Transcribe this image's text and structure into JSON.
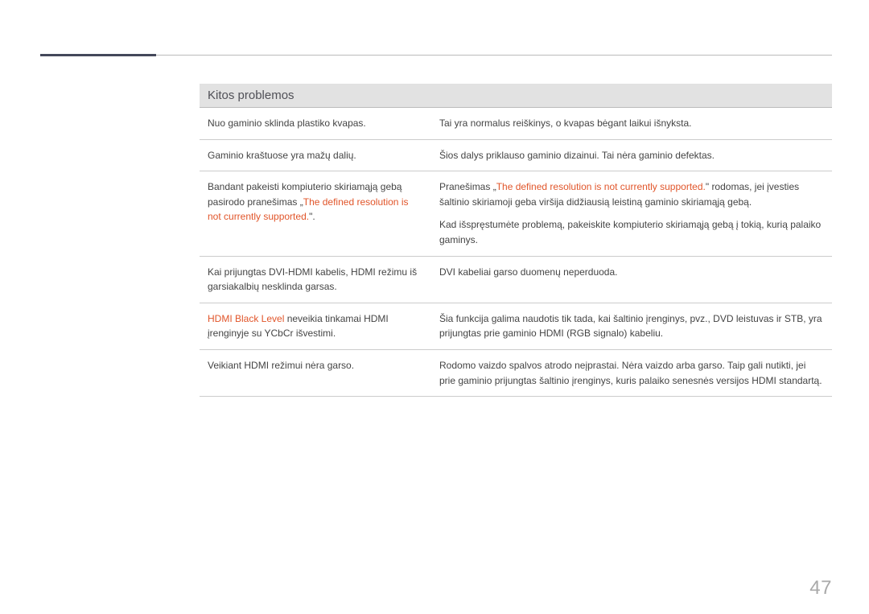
{
  "section_title": "Kitos problemos",
  "rows": [
    {
      "left_plain": "Nuo gaminio sklinda plastiko kvapas.",
      "right_plain": "Tai yra normalus reiškinys, o kvapas bėgant laikui išnyksta."
    },
    {
      "left_plain": "Gaminio kraštuose yra mažų dalių.",
      "right_plain": "Šios dalys priklauso gaminio dizainui. Tai nėra gaminio defektas."
    },
    {
      "left_pre": "Bandant pakeisti kompiuterio skiriamąją gebą pasirodo pranešimas „",
      "left_hl": "The defined resolution is not currently supported.",
      "left_post": "\".",
      "right_p1_pre": "Pranešimas „",
      "right_p1_hl": "The defined resolution is not currently supported.",
      "right_p1_post": "\" rodomas, jei įvesties šaltinio skiriamoji geba viršija didžiausią leistiną gaminio skiriamąją gebą.",
      "right_p2": "Kad išspręstumėte problemą, pakeiskite kompiuterio skiriamąją gebą į tokią, kurią palaiko gaminys."
    },
    {
      "left_plain": "Kai prijungtas DVI-HDMI kabelis, HDMI režimu iš garsiakalbių nesklinda garsas.",
      "right_plain": "DVI kabeliai garso duomenų neperduoda."
    },
    {
      "left_hl_lead": "HDMI Black Level",
      "left_post_lead": " neveikia tinkamai HDMI įrenginyje su YCbCr išvestimi.",
      "right_plain": "Šia funkcija galima naudotis tik tada, kai šaltinio įrenginys, pvz., DVD leistuvas ir STB, yra prijungtas prie gaminio HDMI (RGB signalo) kabeliu."
    },
    {
      "left_plain": "Veikiant HDMI režimui nėra garso.",
      "right_plain": "Rodomo vaizdo spalvos atrodo neįprastai. Nėra vaizdo arba garso. Taip gali nutikti, jei prie gaminio prijungtas šaltinio įrenginys, kuris palaiko senesnės versijos HDMI standartą."
    }
  ],
  "page_number": "47"
}
